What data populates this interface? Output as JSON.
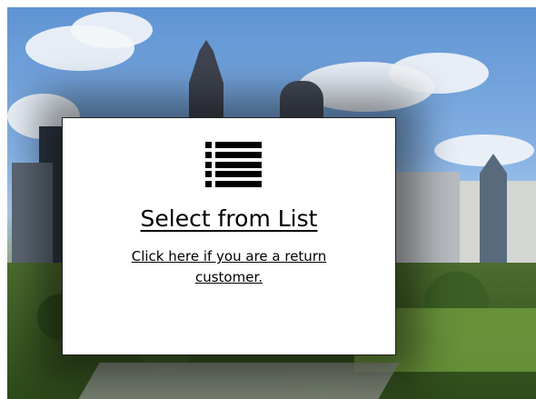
{
  "modal": {
    "icon": "list-icon",
    "title": "Select from List",
    "link_text": "Click here if you are a return customer."
  },
  "colors": {
    "modal_bg": "#ffffff",
    "text": "#000000"
  }
}
